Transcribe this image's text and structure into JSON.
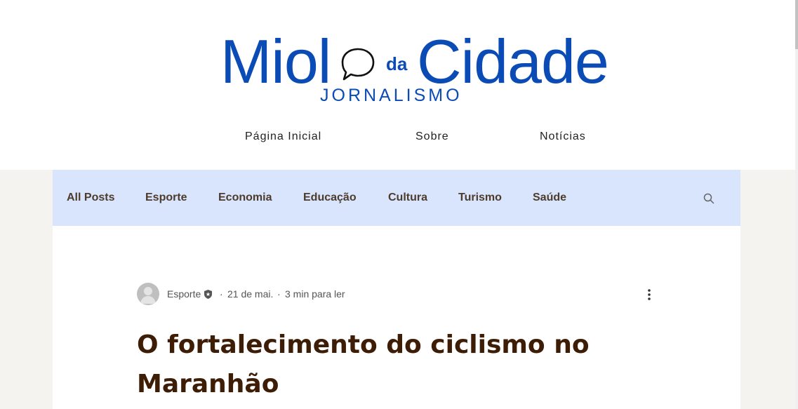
{
  "logo": {
    "word1": "Miol",
    "connector": "da",
    "word2": "Cidade",
    "subtitle": "JORNALISMO",
    "bubble_icon": "speech-bubble-icon",
    "color": "#0a4bb5"
  },
  "topnav": {
    "home": "Página Inicial",
    "about": "Sobre",
    "news": "Notícias"
  },
  "categories": {
    "all": "All Posts",
    "esporte": "Esporte",
    "economia": "Economia",
    "educacao": "Educação",
    "cultura": "Cultura",
    "turismo": "Turismo",
    "saude": "Saúde",
    "search_icon": "search-icon",
    "bar_color": "#d9e4fd",
    "text_color": "#4d3b2c"
  },
  "post": {
    "author": "Esporte",
    "author_badge_icon": "admin-badge-icon",
    "separator": "·",
    "date": "21 de mai.",
    "read_time": "3 min para ler",
    "more_icon": "more-vertical-icon",
    "title": "O fortalecimento do ciclismo no Maranhão",
    "title_color": "#3e1d06"
  }
}
